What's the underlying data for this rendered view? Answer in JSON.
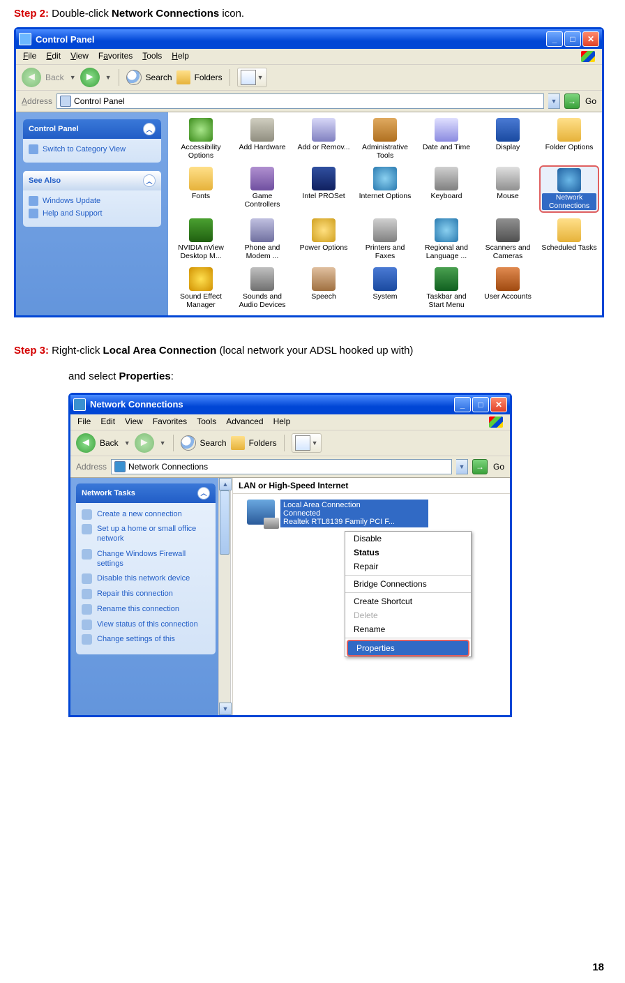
{
  "step2": {
    "label": "Step 2:",
    "before": " Double-click ",
    "bold": "Network Connections",
    "after": " icon."
  },
  "step3": {
    "label": "Step 3:",
    "l1_before": " Right-click ",
    "l1_bold": "Local Area Connection",
    "l1_after": " (local network your ADSL hooked up with)",
    "l2_before": "and select ",
    "l2_bold": "Properties",
    "l2_after": ":"
  },
  "page_number": "18",
  "win1": {
    "title": "Control Panel",
    "menu": [
      "File",
      "Edit",
      "View",
      "Favorites",
      "Tools",
      "Help"
    ],
    "back": "Back",
    "search": "Search",
    "folders": "Folders",
    "address_lbl": "Address",
    "address_val": "Control Panel",
    "go": "Go",
    "side_cp_title": "Control Panel",
    "side_cp_link": "Switch to Category View",
    "side_sa_title": "See Also",
    "side_sa_links": [
      "Windows Update",
      "Help and Support"
    ],
    "items": [
      "Accessibility Options",
      "Add Hardware",
      "Add or Remov...",
      "Administrative Tools",
      "Date and Time",
      "Display",
      "Folder Options",
      "Fonts",
      "Game Controllers",
      "Intel PROSet",
      "Internet Options",
      "Keyboard",
      "Mouse",
      "Network Connections",
      "NVIDIA nView Desktop M...",
      "Phone and Modem ...",
      "Power Options",
      "Printers and Faxes",
      "Regional and Language ...",
      "Scanners and Cameras",
      "Scheduled Tasks",
      "Sound Effect Manager",
      "Sounds and Audio Devices",
      "Speech",
      "System",
      "Taskbar and Start Menu",
      "User Accounts"
    ]
  },
  "win2": {
    "title": "Network Connections",
    "menu": [
      "File",
      "Edit",
      "View",
      "Favorites",
      "Tools",
      "Advanced",
      "Help"
    ],
    "back": "Back",
    "search": "Search",
    "folders": "Folders",
    "address_lbl": "Address",
    "address_val": "Network Connections",
    "go": "Go",
    "tasks_title": "Network Tasks",
    "tasks": [
      "Create a new connection",
      "Set up a home or small office network",
      "Change Windows Firewall settings",
      "Disable this network device",
      "Repair this connection",
      "Rename this connection",
      "View status of this connection",
      "Change settings of this"
    ],
    "category": "LAN or High-Speed Internet",
    "lac": {
      "l1": "Local Area Connection",
      "l2": "Connected",
      "l3": "Realtek RTL8139 Family PCI F..."
    },
    "ctx": [
      "Disable",
      "Status",
      "Repair",
      "Bridge Connections",
      "Create Shortcut",
      "Delete",
      "Rename",
      "Properties"
    ]
  }
}
